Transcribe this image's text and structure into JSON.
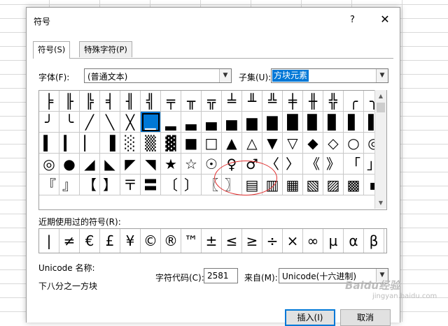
{
  "dialog": {
    "title": "符号",
    "help": "?",
    "close": "✕"
  },
  "tabs": [
    {
      "label": "符号(S)",
      "active": true
    },
    {
      "label": "特殊字符(P)",
      "active": false
    }
  ],
  "font": {
    "label": "字体(F):",
    "value": "(普通文本)"
  },
  "subset": {
    "label": "子集(U):",
    "value": "方块元素"
  },
  "symbol_grid": {
    "rows": [
      [
        "╞",
        "╟",
        "╠",
        "╡",
        "╢",
        "╣",
        "╤",
        "╥",
        "╦",
        "╧",
        "╨",
        "╩",
        "╪",
        "╫",
        "╬",
        "╭",
        "╮"
      ],
      [
        "╯",
        "╰",
        "╱",
        "╲",
        "╳",
        "▁",
        "▂",
        "▃",
        "▄",
        "▅",
        "▆",
        "▇",
        "█",
        "▉",
        "▊",
        "▋",
        "▌"
      ],
      [
        "▍",
        "▎",
        "▏",
        "▐",
        "░",
        "▒",
        "▓",
        "■",
        "□",
        "▲",
        "△",
        "▼",
        "▽",
        "◆",
        "◇",
        "○",
        "◎"
      ],
      [
        "◎",
        "●",
        "◢",
        "◣",
        "◤",
        "◥",
        "★",
        "☆",
        "☉",
        "♀",
        "♂",
        "〈",
        "〉",
        "《",
        "》",
        "「",
        "」"
      ],
      [
        "『",
        "』",
        "【",
        "】",
        "〒",
        "〓",
        "〔",
        "〕",
        "〖",
        "〗",
        "▤",
        "▥",
        "▦",
        "▧",
        "▨",
        "▩",
        "▪"
      ]
    ],
    "selected_row": 1,
    "selected_col": 5
  },
  "recent": {
    "label": "近期使用过的符号(R):",
    "symbols": [
      "|",
      "≠",
      "€",
      "£",
      "¥",
      "©",
      "®",
      "™",
      "±",
      "≤",
      "≥",
      "÷",
      "×",
      "∞",
      "µ",
      "α",
      "β"
    ]
  },
  "unicode_name_label": "Unicode 名称:",
  "unicode_name_value": "下八分之一方块",
  "char_code": {
    "label": "字符代码(C):",
    "value": "2581"
  },
  "from": {
    "label": "来自(M):",
    "value": "Unicode(十六进制)"
  },
  "buttons": {
    "insert": "插入(I)",
    "cancel": "取消"
  },
  "watermark": {
    "text": "Baidu经验",
    "sub": "jingyan.baidu.com"
  }
}
